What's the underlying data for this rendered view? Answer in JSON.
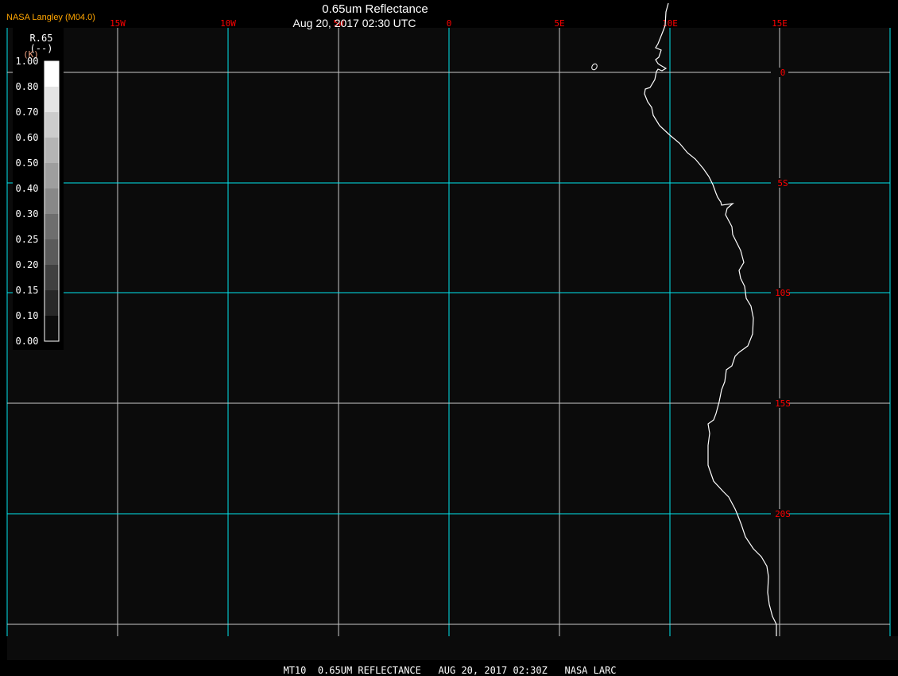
{
  "header": {
    "producer": "NASA Langley (M04.0)",
    "title": "0.65um Reflectance",
    "datetime": "Aug 20, 2017 02:30 UTC"
  },
  "footer": {
    "caption": "MT10  0.65UM REFLECTANCE   AUG 20, 2017 02:30Z   NASA LARC"
  },
  "legend": {
    "variable": "R.65",
    "units": "(--)",
    "units_overlay": "(K)",
    "ticks": [
      "1.00",
      "0.80",
      "0.70",
      "0.60",
      "0.50",
      "0.40",
      "0.30",
      "0.25",
      "0.20",
      "0.15",
      "0.10",
      "0.00"
    ],
    "bins": [
      "#ffffff",
      "#e4e4e4",
      "#cccccc",
      "#b4b4b4",
      "#9e9e9e",
      "#888888",
      "#6e6e6e",
      "#5a5a5a",
      "#404040",
      "#282828",
      "#0c0c0c"
    ]
  },
  "map": {
    "lon_labels": [
      "15W",
      "10W",
      "5W",
      "0",
      "5E",
      "10E",
      "15E"
    ],
    "lat_labels": [
      "0",
      "5S",
      "10S",
      "15S",
      "20S"
    ],
    "colors": {
      "background": "#0b0b0b",
      "grid_major": "#00e5ee",
      "grid_minor": "#c8c8c8",
      "coastline": "#ffffff",
      "grid_label": "#ff0000",
      "producer": "#ffa500"
    }
  }
}
